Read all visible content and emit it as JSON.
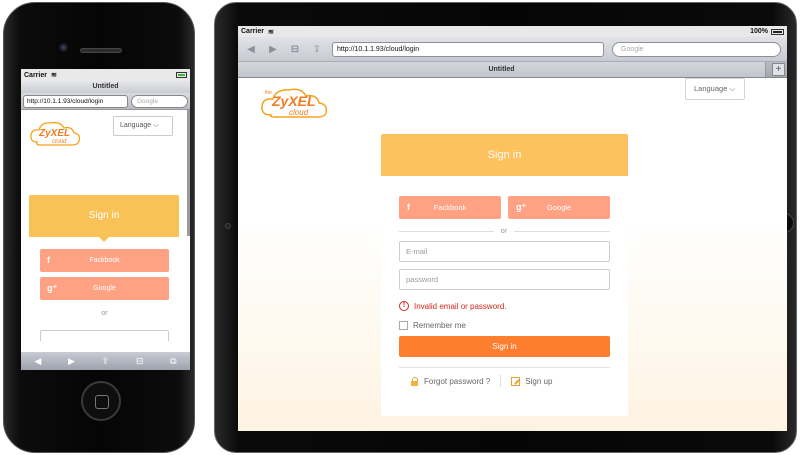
{
  "phone": {
    "status": {
      "carrier": "Carrier"
    },
    "browser": {
      "title": "Untitled",
      "url": "http://10.1.1.93/cloud/login",
      "search_placeholder": "Google"
    },
    "page": {
      "language_label": "Language ⌵",
      "signin_title": "Sign in",
      "facebook_label": "Fackbook",
      "google_label": "Google",
      "or_label": "or"
    },
    "toolbar": [
      "◀",
      "▶",
      "⇪",
      "⊟",
      "⧉"
    ]
  },
  "tablet": {
    "status": {
      "carrier": "Carrier",
      "battery": "100%"
    },
    "browser": {
      "url": "http://10.1.1.93/cloud/login",
      "search_placeholder": "Google",
      "tab_title": "Untitled",
      "new_tab": "+"
    },
    "page": {
      "logo_text": "ZyXEL cloud",
      "language_label": "Language ⌵",
      "signin_title": "Sign in",
      "facebook_label": "Fackbook",
      "google_label": "Google",
      "or_label": "or",
      "email_placeholder": "E-mail",
      "password_placeholder": "password",
      "error_message": "Invalid email or password.",
      "remember_label": "Remember me",
      "signin_button": "Sign in",
      "forgot_link": "Forgot password ?",
      "signup_link": "Sign up"
    }
  },
  "colors": {
    "header_yellow": "#fdc15e",
    "social_salmon": "#ffa183",
    "signin_orange": "#fd7e2f",
    "error_red": "#d0281b"
  }
}
